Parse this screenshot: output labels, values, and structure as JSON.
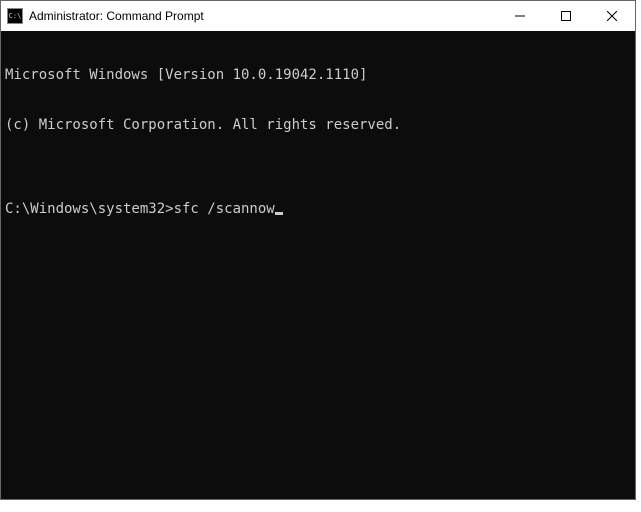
{
  "titlebar": {
    "icon_glyph": "C:\\",
    "title": "Administrator: Command Prompt"
  },
  "terminal": {
    "line1": "Microsoft Windows [Version 10.0.19042.1110]",
    "line2": "(c) Microsoft Corporation. All rights reserved.",
    "blank": "",
    "prompt": "C:\\Windows\\system32>",
    "command": "sfc /scannow"
  }
}
